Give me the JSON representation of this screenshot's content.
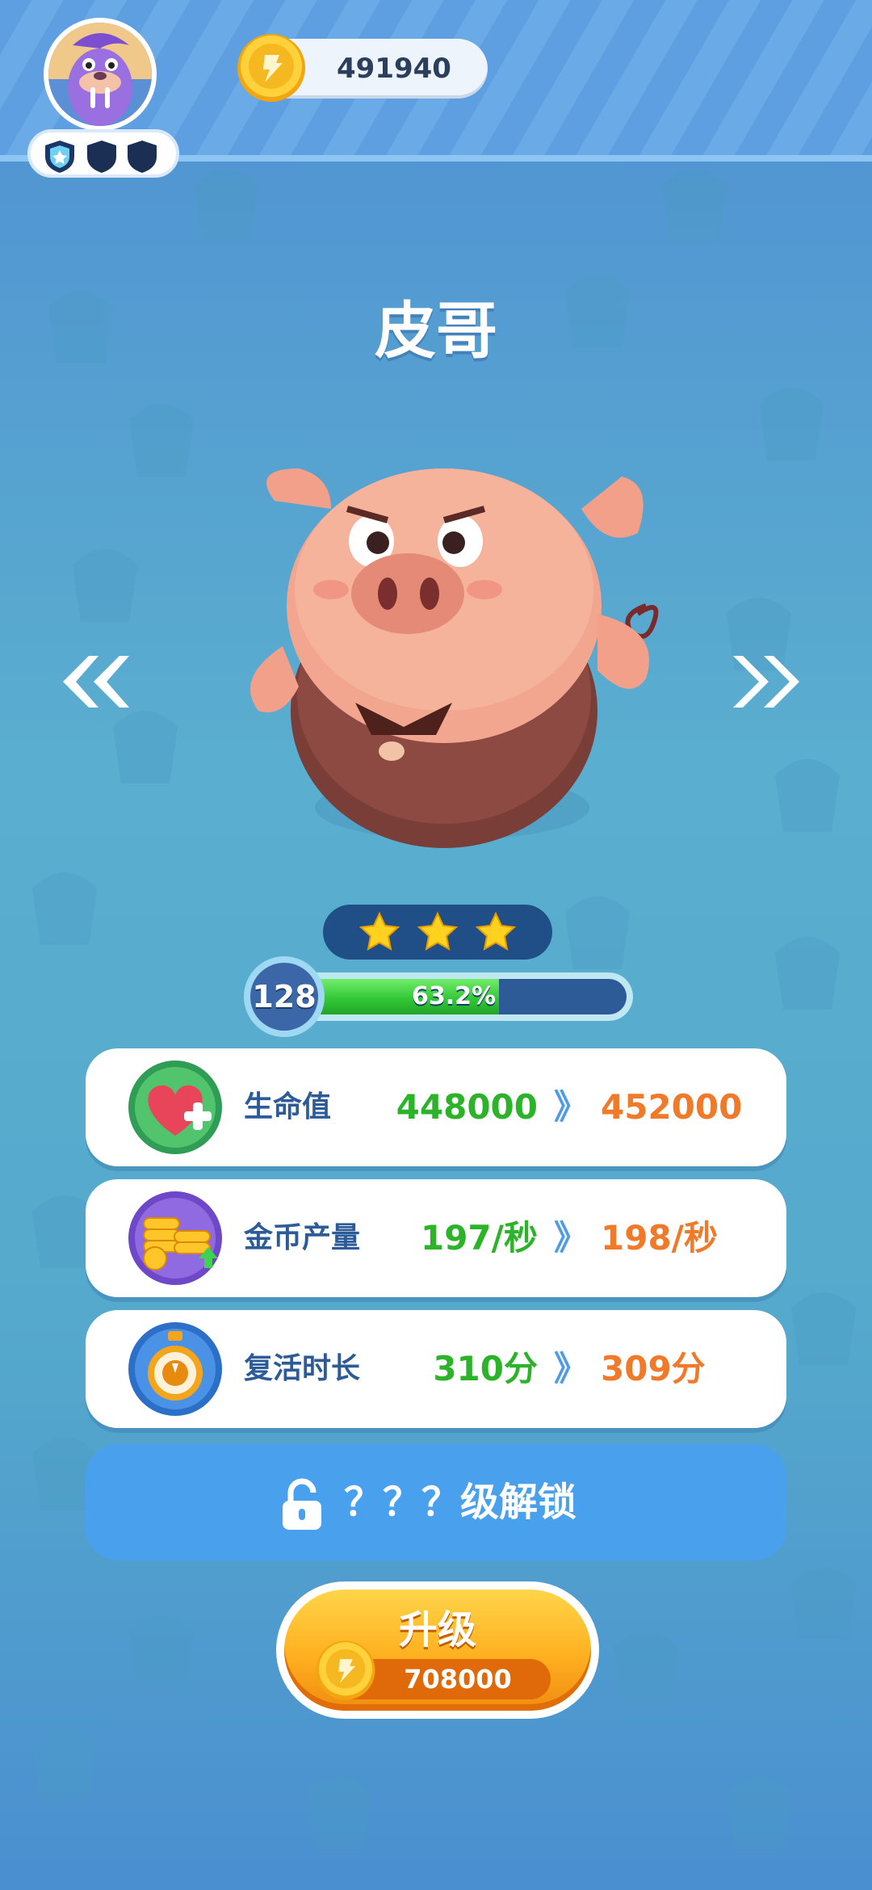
{
  "header": {
    "coins": "491940"
  },
  "character": {
    "name": "皮哥",
    "stars": 3,
    "level": "128",
    "progress_text": "63.2%",
    "progress": 0.632
  },
  "stats": [
    {
      "label": "生命值",
      "current": "448000",
      "next": "452000",
      "icon": "heart-plus-icon"
    },
    {
      "label": "金币产量",
      "current": "197/秒",
      "next": "198/秒",
      "icon": "coin-stack-icon"
    },
    {
      "label": "复活时长",
      "current": "310分",
      "next": "309分",
      "icon": "stopwatch-icon"
    }
  ],
  "stat_arrow": "》",
  "unlock": {
    "text": "？？？级解锁"
  },
  "upgrade": {
    "label": "升级",
    "cost": "708000"
  },
  "nav": {
    "prev": "«",
    "next": "»"
  },
  "colors": {
    "accent_blue": "#49a0ec",
    "stat_green": "#2db32a",
    "stat_orange": "#f07a2a",
    "button_orange": "#ffb020"
  }
}
